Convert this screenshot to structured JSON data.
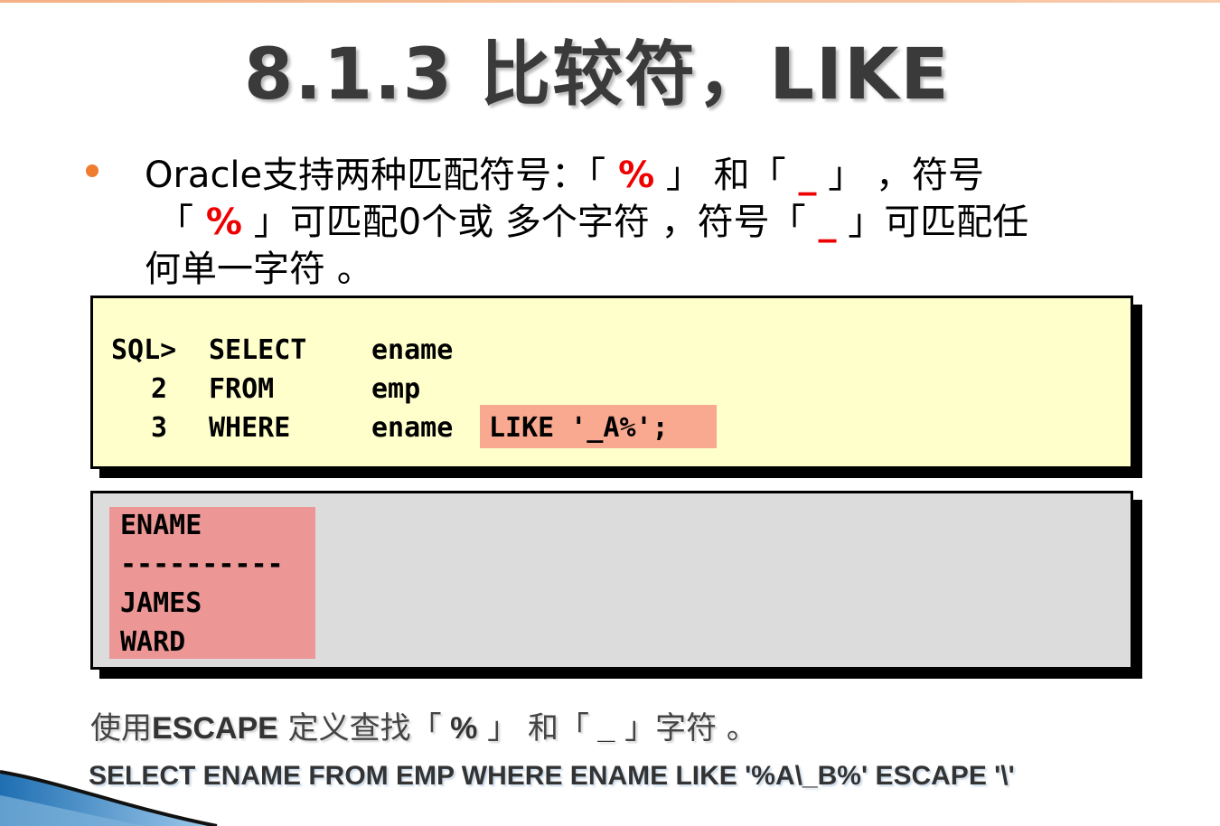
{
  "title": "8.1.3 比较符，LIKE",
  "paragraph": {
    "line1_a": "Oracle支持两种匹配符号：「",
    "line1_pct": " %",
    "line1_b": " 」 和「",
    "line1_us": " _",
    "line1_c": " 」 ，符号",
    "line2_a": "「",
    "line2_pct": " %",
    "line2_b": " 」可匹配0个或 多个字符 ，符号「",
    "line2_us": " _",
    "line2_c": " 」可匹配任",
    "line3": "何单一字符 。"
  },
  "code": {
    "lines": [
      {
        "num": "SQL>",
        "kw": "SELECT",
        "arg": "ename"
      },
      {
        "num": "2",
        "kw": "FROM",
        "arg": "emp"
      },
      {
        "num": "3",
        "kw": "WHERE",
        "arg": "ename"
      }
    ],
    "highlight": "LIKE '_A%';"
  },
  "output": {
    "header": "ENAME",
    "separator": "----------",
    "rows": [
      "JAMES",
      "WARD"
    ]
  },
  "note": {
    "a": "使用",
    "b": "ESCAPE",
    "c": " 定义查找「",
    "d": " %",
    "e": " 」 和「",
    "f": " _",
    "g": " 」字符 。"
  },
  "sql_example": "SELECT ENAME FROM EMP WHERE ENAME LIKE '%A\\_B%' ESCAPE '\\'",
  "colors": {
    "accent": "#ee7d2f",
    "code_bg": "#ffffcc",
    "code_highlight": "#f8a98f",
    "output_bg": "#dcdcdc",
    "output_highlight": "#ec9695",
    "red_symbol": "#ee0000"
  }
}
